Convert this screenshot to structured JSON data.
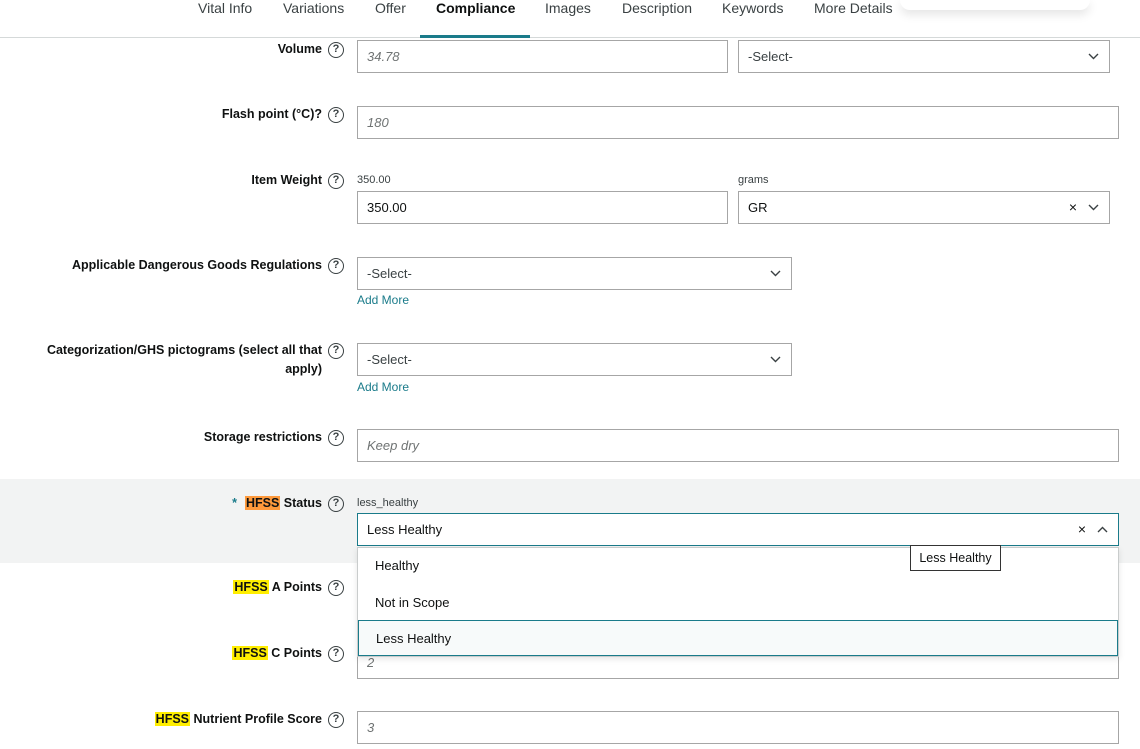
{
  "tabs": [
    {
      "label": "Vital Info",
      "active": false
    },
    {
      "label": "Variations",
      "active": false
    },
    {
      "label": "Offer",
      "active": false
    },
    {
      "label": "Compliance",
      "active": true
    },
    {
      "label": "Images",
      "active": false
    },
    {
      "label": "Description",
      "active": false
    },
    {
      "label": "Keywords",
      "active": false
    },
    {
      "label": "More Details",
      "active": false
    }
  ],
  "help_glyph": "?",
  "fields": {
    "volume": {
      "label": "Volume",
      "value_placeholder": "34.78",
      "unit_select": "-Select-"
    },
    "flash_point": {
      "label": "Flash point (°C)?",
      "placeholder": "180"
    },
    "item_weight": {
      "label": "Item Weight",
      "hint": "350.00",
      "value": "350.00",
      "unit_hint": "grams",
      "unit_value": "GR"
    },
    "dangerous_goods": {
      "label": "Applicable Dangerous Goods Regulations",
      "select": "-Select-",
      "add_more": "Add More"
    },
    "ghs": {
      "label_line1": "Categorization/GHS pictograms (select all that",
      "label_line2": "apply)",
      "select": "-Select-",
      "add_more": "Add More"
    },
    "storage": {
      "label": "Storage restrictions",
      "placeholder": "Keep dry"
    },
    "hfss_status": {
      "required_mark": "*",
      "hl": "HFSS",
      "label_rest": "Status",
      "hint": "less_healthy",
      "value": "Less Healthy"
    },
    "hfss_a": {
      "hl": "HFSS",
      "label_rest": "A Points"
    },
    "hfss_c": {
      "hl": "HFSS",
      "label_rest": "C Points",
      "placeholder": "2"
    },
    "hfss_npscore": {
      "hl": "HFSS",
      "label_rest": "Nutrient Profile Score",
      "placeholder": "3"
    }
  },
  "dropdown": {
    "options": [
      "Healthy",
      "Not in Scope",
      "Less Healthy"
    ],
    "selected": "Less Healthy"
  },
  "tooltip": "Less Healthy",
  "clear_glyph": "×",
  "colors": {
    "accent": "#1a7b8a",
    "highlight_yellow": "#ffee00",
    "highlight_orange": "#ff9a3c",
    "row_highlight": "#f2f3f3"
  }
}
